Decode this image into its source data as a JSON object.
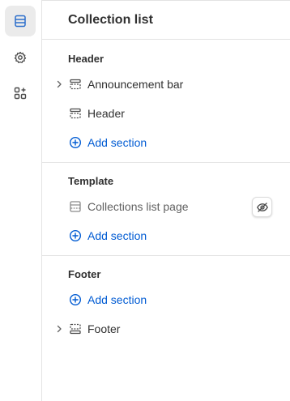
{
  "sidebar": {
    "items": [
      {
        "icon": "sections-icon",
        "active": true
      },
      {
        "icon": "gear-icon",
        "active": false
      },
      {
        "icon": "apps-add-icon",
        "active": false
      }
    ]
  },
  "panel": {
    "title": "Collection list",
    "groups": {
      "header": {
        "title": "Header",
        "items": [
          {
            "label": "Announcement bar",
            "icon": "section-layout-icon",
            "expandable": true
          },
          {
            "label": "Header",
            "icon": "section-layout-icon",
            "expandable": false
          }
        ],
        "add_label": "Add section"
      },
      "template": {
        "title": "Template",
        "items": [
          {
            "label": "Collections list page",
            "icon": "template-section-icon",
            "hidden": true
          }
        ],
        "add_label": "Add section"
      },
      "footer": {
        "title": "Footer",
        "add_label": "Add section",
        "items": [
          {
            "label": "Footer",
            "icon": "footer-section-icon",
            "expandable": true
          }
        ]
      }
    }
  },
  "colors": {
    "accent": "#005bd3",
    "text": "#303030",
    "muted_text": "#616161",
    "border": "#e3e3e3",
    "active_bg": "#ebebeb"
  }
}
